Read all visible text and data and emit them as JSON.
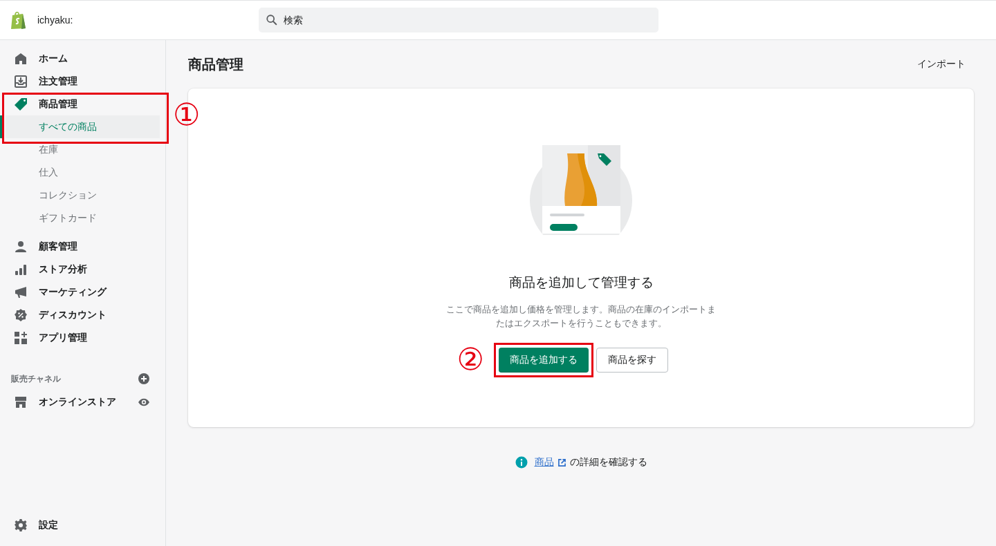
{
  "header": {
    "store_name": "ichyaku:",
    "search": {
      "placeholder": "検索"
    }
  },
  "sidebar": {
    "items": [
      {
        "label": "ホーム",
        "selected": false
      },
      {
        "label": "注文管理",
        "selected": false
      },
      {
        "label": "商品管理",
        "selected": true,
        "annotation": "①",
        "children": [
          {
            "label": "すべての商品",
            "selected": true
          },
          {
            "label": "在庫",
            "selected": false
          },
          {
            "label": "仕入",
            "selected": false
          },
          {
            "label": "コレクション",
            "selected": false
          },
          {
            "label": "ギフトカード",
            "selected": false
          }
        ]
      },
      {
        "label": "顧客管理",
        "selected": false
      },
      {
        "label": "ストア分析",
        "selected": false
      },
      {
        "label": "マーケティング",
        "selected": false
      },
      {
        "label": "ディスカウント",
        "selected": false
      },
      {
        "label": "アプリ管理",
        "selected": false
      }
    ],
    "channels_heading": "販売チャネル",
    "channels": [
      {
        "label": "オンラインストア"
      }
    ],
    "settings": "設定"
  },
  "page": {
    "title": "商品管理",
    "import": "インポート",
    "empty_state": {
      "heading": "商品を追加して管理する",
      "text": "ここで商品を追加し価格を管理します。商品の在庫のインポートまたはエクスポートを行うこともできます。",
      "primary": {
        "label": "商品を追加する",
        "annotation": "②"
      },
      "secondary": "商品を探す"
    },
    "help": {
      "link": "商品",
      "text": "の詳細を確認する"
    }
  }
}
